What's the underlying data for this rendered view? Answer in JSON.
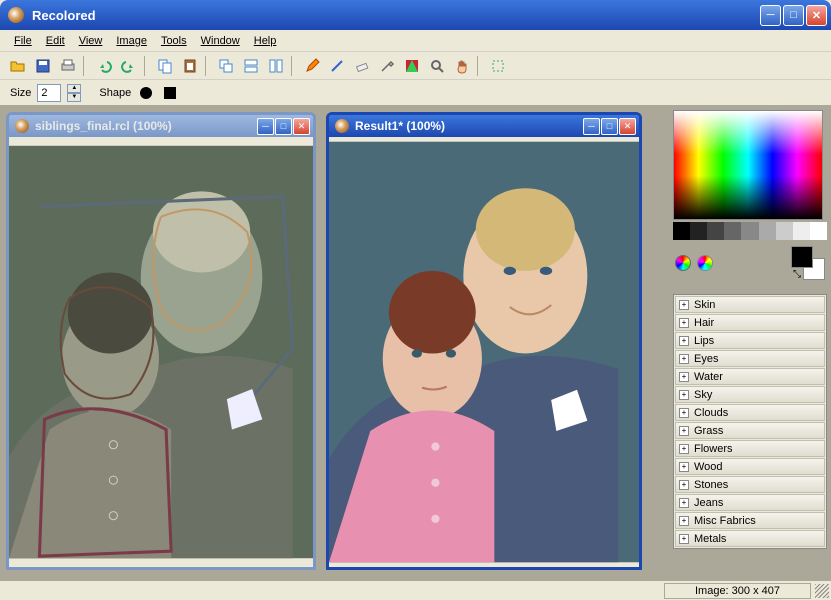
{
  "app_title": "Recolored",
  "menus": [
    "File",
    "Edit",
    "View",
    "Image",
    "Tools",
    "Window",
    "Help"
  ],
  "size_label": "Size",
  "size_value": "2",
  "shape_label": "Shape",
  "doc1_title": "siblings_final.rcl (100%)",
  "doc2_title": "Result1* (100%)",
  "categories": [
    "Skin",
    "Hair",
    "Lips",
    "Eyes",
    "Water",
    "Sky",
    "Clouds",
    "Grass",
    "Flowers",
    "Wood",
    "Stones",
    "Jeans",
    "Misc Fabrics",
    "Metals"
  ],
  "status_text": "Image: 300 x 407",
  "colors": {
    "fg": "#000000",
    "bg": "#ffffff"
  }
}
